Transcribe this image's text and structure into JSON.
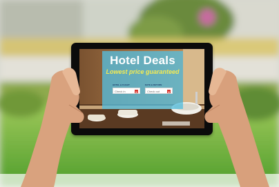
{
  "scene": {
    "description_colors": {
      "panel": "#56bede",
      "title": "#ffffff",
      "subtitle": "#f4ea52",
      "calendar_accent": "#d8372f"
    }
  },
  "tablet_screen": {
    "title": "Hotel Deals",
    "subtitle": "Lowest price guaranteed",
    "booking": {
      "checkin_heading": "HOTEL & FLIGHT",
      "checkin_label": "Check in",
      "checkout_heading": "DATE & RETURN",
      "checkout_label": "Check out"
    }
  }
}
